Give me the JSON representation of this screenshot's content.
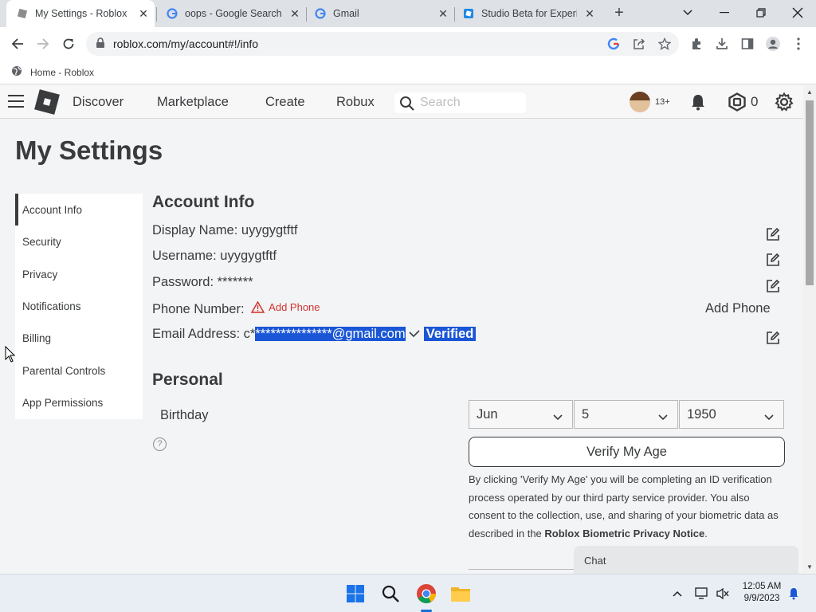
{
  "browser": {
    "tabs": [
      {
        "title": "My Settings - Roblox",
        "active": true
      },
      {
        "title": "oops - Google Search",
        "active": false
      },
      {
        "title": "Gmail",
        "active": false
      },
      {
        "title": "Studio Beta for Experie",
        "active": false
      }
    ],
    "new_tab_label": "+",
    "url": "roblox.com/my/account#!/info",
    "bookmark": "Home - Roblox"
  },
  "header": {
    "nav": [
      "Discover",
      "Marketplace",
      "Create",
      "Robux"
    ],
    "search_placeholder": "Search",
    "age_badge": "13+",
    "robux_count": "0"
  },
  "page": {
    "title": "My Settings",
    "sidebar": [
      {
        "label": "Account Info",
        "active": true
      },
      {
        "label": "Security"
      },
      {
        "label": "Privacy"
      },
      {
        "label": "Notifications"
      },
      {
        "label": "Billing"
      },
      {
        "label": "Parental Controls"
      },
      {
        "label": "App Permissions"
      }
    ],
    "account_info": {
      "heading": "Account Info",
      "display_name_label": "Display Name:",
      "display_name": "uyygygtftf",
      "username_label": "Username:",
      "username": "uyygygtftf",
      "password_label": "Password:",
      "password": "*******",
      "phone_label": "Phone Number:",
      "add_phone_link": "Add Phone",
      "add_phone_button": "Add Phone",
      "email_label": "Email Address:",
      "email_prefix": "c*",
      "email_masked": "***************@gmail.com",
      "email_status": "Verified"
    },
    "personal": {
      "heading": "Personal",
      "birthday_label": "Birthday",
      "help": "?",
      "month": "Jun",
      "day": "5",
      "year": "1950",
      "verify_button": "Verify My Age",
      "disclaimer_text": "By clicking 'Verify My Age' you will be completing an ID verification process operated by our third party service provider. You also consent to the collection, use, and sharing of your biometric data as described in the ",
      "disclaimer_link": "Roblox Biometric Privacy Notice",
      "disclaimer_end": "."
    },
    "chat_label": "Chat"
  },
  "taskbar": {
    "time": "12:05 AM",
    "date": "9/9/2023"
  },
  "colors": {
    "roblox_text": "#393b3d",
    "warning": "#d2332d",
    "selection": "#1a56d6",
    "chrome_tabstrip": "#dee1e6"
  }
}
